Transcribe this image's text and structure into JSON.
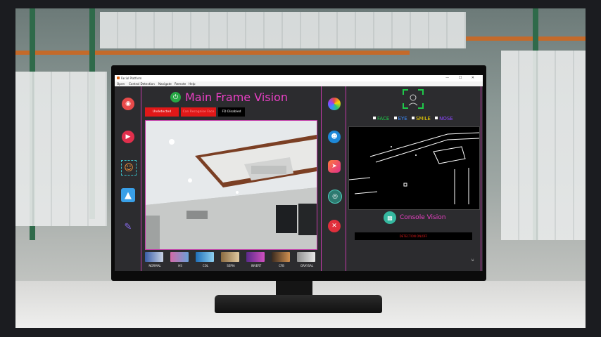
{
  "window": {
    "title": "Facial Platform",
    "controls": "—  ☐  ✕"
  },
  "menu": [
    "Open",
    "Control Detection",
    "Navigate",
    "Remote",
    "Help"
  ],
  "main": {
    "title": "Main Frame Vision",
    "status_buttons": [
      "Undetected",
      "Can Recognise Face",
      "FD Disabled"
    ]
  },
  "filters": [
    "NORMAL",
    "HS",
    "COL",
    "SEPIA",
    "INVERT",
    "CFB",
    "GRAYSAL"
  ],
  "right": {
    "legend": {
      "face": "FACE",
      "eye": "EYE",
      "smile": "SMILE",
      "nose": "NOSE"
    },
    "console_title": "Console Vision",
    "console_text": "DETECTION ON/OFF"
  },
  "colors": {
    "accent": "#e940c4",
    "face": "#1fc94a",
    "eye": "#3c8cff",
    "smile": "#f5d800",
    "nose": "#8b46ff",
    "danger": "#e01818"
  },
  "icons": {
    "left": [
      "camera-icon",
      "video-icon",
      "face-scan-icon",
      "image-gallery-icon",
      "edit-icon"
    ],
    "middle": [
      "color-wheel-icon",
      "user-icon",
      "app-launch-icon",
      "circle-target-icon",
      "close-icon"
    ]
  }
}
